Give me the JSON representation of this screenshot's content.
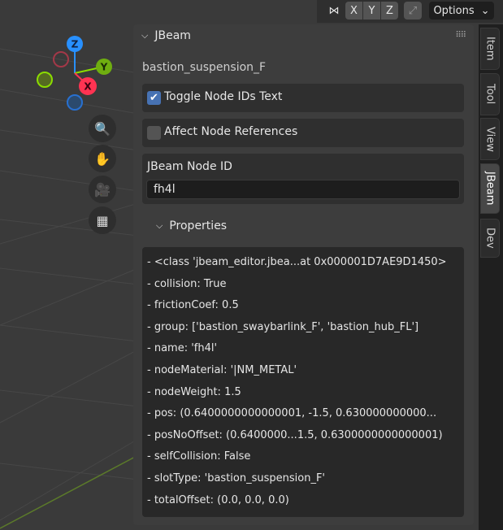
{
  "header": {
    "axes": [
      "X",
      "Y",
      "Z"
    ],
    "options_label": "Options"
  },
  "gizmo": {
    "z": "Z",
    "y": "Y",
    "x": "X"
  },
  "panel": {
    "title": "JBeam",
    "part_name": "bastion_suspension_F",
    "toggle_node_ids": {
      "label": "Toggle Node IDs Text",
      "checked": true
    },
    "affect_node_refs": {
      "label": "Affect Node References",
      "checked": false
    },
    "node_id": {
      "label": "JBeam Node ID",
      "value": "fh4l"
    },
    "properties": {
      "label": "Properties",
      "lines": [
        "- <class 'jbeam_editor.jbea...at 0x000001D7AE9D1450>",
        "- collision: True",
        "- frictionCoef: 0.5",
        "- group: ['bastion_swaybarlink_F', 'bastion_hub_FL']",
        "- name: 'fh4l'",
        "- nodeMaterial: '|NM_METAL'",
        "- nodeWeight: 1.5",
        "- pos: (0.6400000000000001, -1.5, 0.630000000000...",
        "- posNoOffset: (0.6400000...1.5, 0.6300000000000001)",
        "- selfCollision: False",
        "- slotType: 'bastion_suspension_F'",
        "- totalOffset: (0.0, 0.0, 0.0)"
      ]
    }
  },
  "tabs": [
    "Item",
    "Tool",
    "View",
    "JBeam",
    "Dev"
  ],
  "colors": {
    "accent": "#4772b3",
    "x": "#ff3352",
    "y": "#8bdc00",
    "z": "#2890ff"
  }
}
